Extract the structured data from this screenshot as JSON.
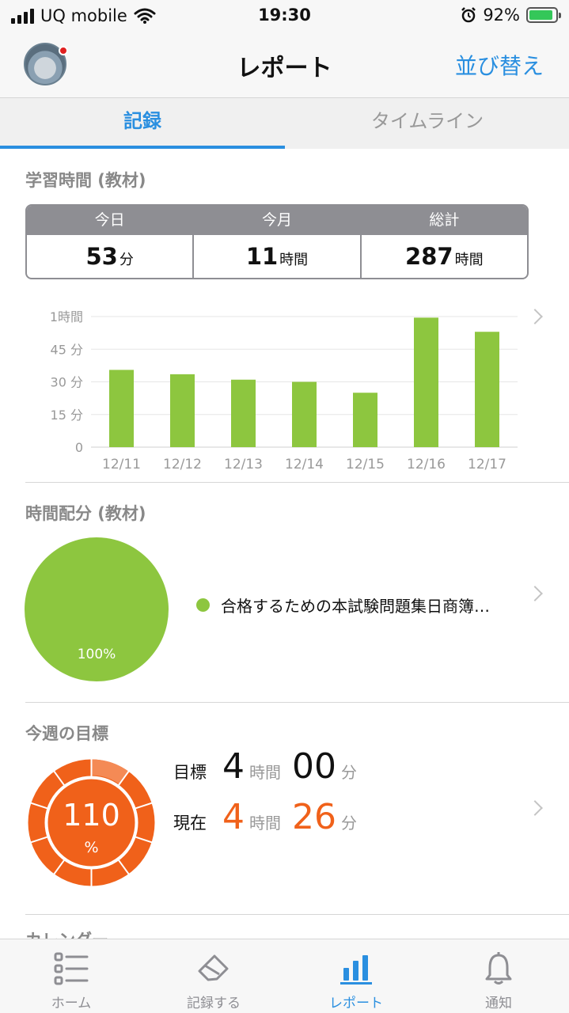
{
  "status_bar": {
    "carrier": "UQ mobile",
    "time": "19:30",
    "battery": "92%",
    "battery_level": 0.92,
    "icons": [
      "signal-icon",
      "wifi-icon",
      "alarm-icon",
      "battery-charging-icon"
    ]
  },
  "navbar": {
    "title": "レポート",
    "sort_label": "並び替え"
  },
  "tabs": [
    {
      "label": "記録",
      "active": true
    },
    {
      "label": "タイムライン",
      "active": false
    }
  ],
  "study_time": {
    "title": "学習時間 (教材)",
    "cells": [
      {
        "head": "今日",
        "value": "53",
        "unit": "分"
      },
      {
        "head": "今月",
        "value": "11",
        "unit": "時間"
      },
      {
        "head": "総計",
        "value": "287",
        "unit": "時間"
      }
    ]
  },
  "chart_data": {
    "type": "bar",
    "categories": [
      "12/11",
      "12/12",
      "12/13",
      "12/14",
      "12/15",
      "12/16",
      "12/17"
    ],
    "values": [
      35.5,
      33.5,
      31,
      30,
      25,
      59.5,
      53
    ],
    "y_ticks": [
      "0",
      "15 分",
      "30 分",
      "45 分",
      "1時間"
    ],
    "y_tick_values": [
      0,
      15,
      30,
      45,
      60
    ],
    "ylim": [
      0,
      60
    ],
    "grid": true,
    "color": "#8dc63f"
  },
  "allocation": {
    "title": "時間配分 (教材)",
    "percent_label": "100%",
    "legend_item": "合格するための本試験問題集日商簿…",
    "color": "#8dc63f"
  },
  "weekly_goal": {
    "title": "今週の目標",
    "percent": "110",
    "percent_sign": "%",
    "target_label": "目標",
    "target_hours": "4",
    "target_minutes": "00",
    "current_label": "現在",
    "current_hours": "4",
    "current_minutes": "26",
    "hours_unit": "時間",
    "minutes_unit": "分",
    "accent": "#f0611a"
  },
  "next_section_title": "カレンダー",
  "tabbar": [
    {
      "label": "ホーム",
      "icon": "list-icon",
      "active": false
    },
    {
      "label": "記録する",
      "icon": "eraser-icon",
      "active": false
    },
    {
      "label": "レポート",
      "icon": "bar-chart-icon",
      "active": true
    },
    {
      "label": "通知",
      "icon": "bell-icon",
      "active": false
    }
  ]
}
